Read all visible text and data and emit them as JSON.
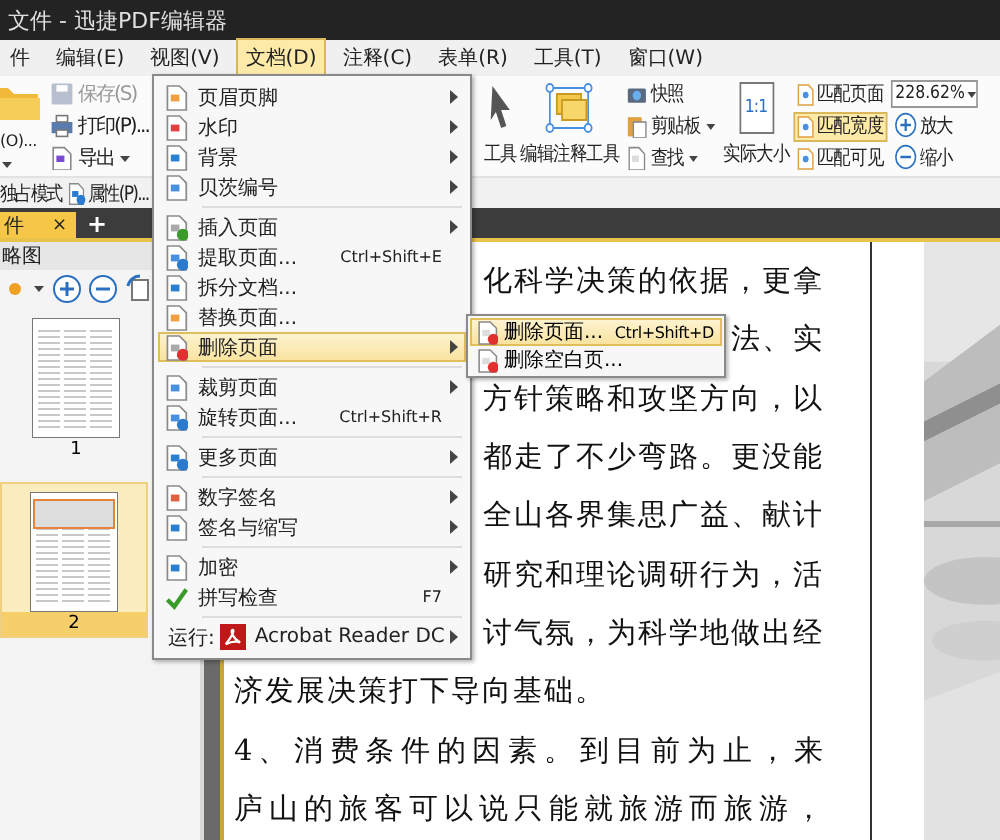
{
  "window": {
    "title": "文件 - 迅捷PDF编辑器"
  },
  "menubar": [
    {
      "label": "件",
      "selected": false
    },
    {
      "label": "编辑(E)",
      "selected": false
    },
    {
      "label": "视图(V)",
      "selected": false
    },
    {
      "label": "文档(D)",
      "selected": true
    },
    {
      "label": "注释(C)",
      "selected": false
    },
    {
      "label": "表单(R)",
      "selected": false
    },
    {
      "label": "工具(T)",
      "selected": false
    },
    {
      "label": "窗口(W)",
      "selected": false
    }
  ],
  "ribbon": {
    "open_label": "(O)...",
    "file_items": [
      {
        "label": "保存(S)",
        "disabled": true,
        "dropdown": false
      },
      {
        "label": "打印(P)...",
        "disabled": false,
        "dropdown": false
      },
      {
        "label": "导出",
        "disabled": false,
        "dropdown": true
      }
    ],
    "tools": [
      {
        "label": "工具"
      },
      {
        "label": "编辑注释工具"
      }
    ],
    "view_items": [
      {
        "label": "快照",
        "dropdown": false
      },
      {
        "label": "剪贴板",
        "dropdown": true
      },
      {
        "label": "查找",
        "dropdown": true
      }
    ],
    "actual_size": {
      "label": "实际大小",
      "icon_text": "1:1"
    },
    "fit_items": [
      {
        "label": "匹配页面",
        "selected": false
      },
      {
        "label": "匹配宽度",
        "selected": true
      },
      {
        "label": "匹配可见",
        "selected": false
      }
    ],
    "zoom": {
      "value": "228.62%",
      "zoom_in": "放大",
      "zoom_out": "缩小"
    }
  },
  "quickbar": [
    {
      "label": "独占模式"
    },
    {
      "label": "属性(P)..."
    }
  ],
  "tabs": [
    {
      "label": "件",
      "selected": true,
      "close": "×"
    }
  ],
  "new_tab": "+",
  "panel": {
    "title": "略图",
    "thumbnails": [
      {
        "label": "1",
        "selected": false
      },
      {
        "label": "2",
        "selected": true
      }
    ]
  },
  "document": {
    "lines": [
      {
        "kind": "tail",
        "text": "化科学决策的依据，更拿"
      },
      {
        "kind": "tail",
        "text": "法、实"
      },
      {
        "kind": "tail",
        "text": "方针策略和攻坚方向，以"
      },
      {
        "kind": "tail",
        "text": "都走了不少弯路。更没能"
      },
      {
        "kind": "tail",
        "text": "全山各界集思广益、献计"
      },
      {
        "kind": "tail",
        "text": "研究和理论调研行为，活"
      },
      {
        "kind": "tail",
        "text": "讨气氛，为科学地做出经"
      },
      {
        "kind": "last",
        "text": "济发展决策打下导向基础。"
      },
      {
        "kind": "full",
        "text": "4、消费条件的因素。到目前为止，来"
      },
      {
        "kind": "full",
        "text": "庐山的旅客可以说只能就旅游而旅游，"
      }
    ]
  },
  "doc_menu": [
    {
      "kind": "item",
      "label": "页眉页脚",
      "submenu": true,
      "selected": false
    },
    {
      "kind": "item",
      "label": "水印",
      "submenu": true,
      "selected": false
    },
    {
      "kind": "item",
      "label": "背景",
      "submenu": true,
      "selected": false
    },
    {
      "kind": "item",
      "label": "贝茨编号",
      "submenu": true,
      "selected": false
    },
    {
      "kind": "separator"
    },
    {
      "kind": "item",
      "label": "插入页面",
      "submenu": true,
      "selected": false
    },
    {
      "kind": "item",
      "label": "提取页面...",
      "shortcut": "Ctrl+Shift+E",
      "submenu": false,
      "selected": false
    },
    {
      "kind": "item",
      "label": "拆分文档...",
      "submenu": false,
      "selected": false
    },
    {
      "kind": "item",
      "label": "替换页面...",
      "submenu": false,
      "selected": false
    },
    {
      "kind": "item",
      "label": "删除页面",
      "submenu": true,
      "selected": true
    },
    {
      "kind": "separator"
    },
    {
      "kind": "item",
      "label": "裁剪页面",
      "submenu": true,
      "selected": false
    },
    {
      "kind": "item",
      "label": "旋转页面...",
      "shortcut": "Ctrl+Shift+R",
      "submenu": false,
      "selected": false
    },
    {
      "kind": "separator"
    },
    {
      "kind": "item",
      "label": "更多页面",
      "submenu": true,
      "selected": false
    },
    {
      "kind": "separator"
    },
    {
      "kind": "item",
      "label": "数字签名",
      "submenu": true,
      "selected": false
    },
    {
      "kind": "item",
      "label": "签名与缩写",
      "submenu": true,
      "selected": false
    },
    {
      "kind": "separator"
    },
    {
      "kind": "item",
      "label": "加密",
      "submenu": true,
      "selected": false
    },
    {
      "kind": "item",
      "label": "拼写检查",
      "shortcut": "F7",
      "submenu": false,
      "selected": false
    },
    {
      "kind": "separator"
    },
    {
      "kind": "run",
      "label": "运行:",
      "app": "Acrobat Reader DC",
      "submenu": true,
      "selected": false
    }
  ],
  "sub_menu": [
    {
      "label": "删除页面...",
      "shortcut": "Ctrl+Shift+D",
      "selected": true
    },
    {
      "label": "删除空白页...",
      "selected": false
    }
  ]
}
